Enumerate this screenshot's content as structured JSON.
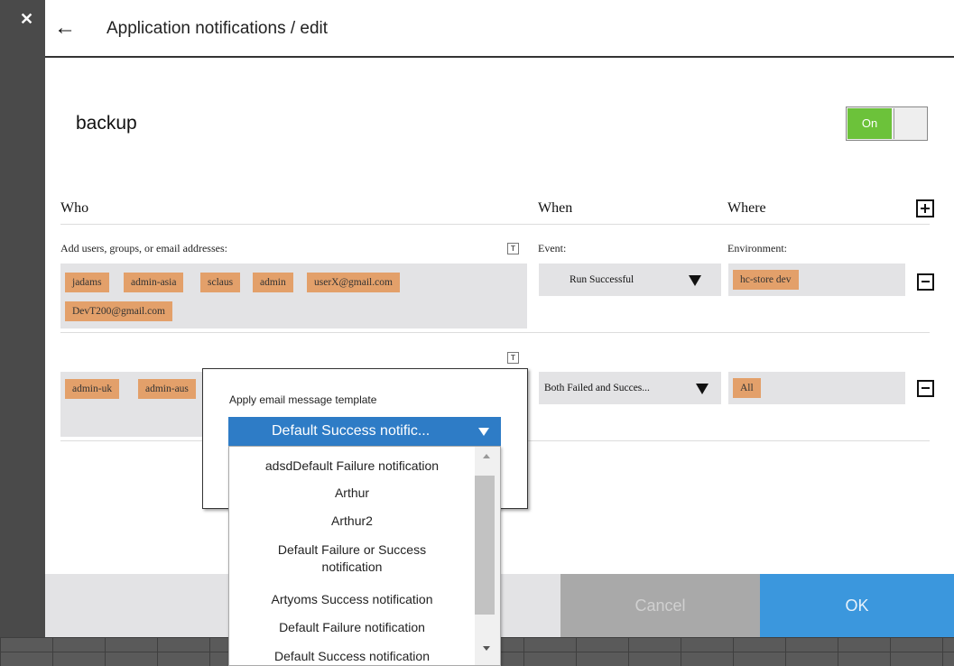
{
  "header": {
    "title": "Application notifications / edit",
    "back_icon": "arrow-left-icon",
    "close_icon": "close-icon"
  },
  "app": {
    "name": "backup",
    "toggle_label": "On",
    "toggle_color": "#6cc23a"
  },
  "columns": {
    "who": "Who",
    "when": "When",
    "where": "Where"
  },
  "rows": [
    {
      "who_label": "Add users, groups, or email addresses:",
      "who_chips": [
        "jadams",
        "admin-asia",
        "sclaus",
        "admin",
        "userX@gmail.com",
        "DevT200@gmail.com"
      ],
      "event_label": "Event:",
      "event_value": "Run Successful",
      "env_label": "Environment:",
      "env_chips": [
        "hc-store dev"
      ]
    },
    {
      "who_chips": [
        "admin-uk",
        "admin-aus"
      ],
      "event_value": "Both Failed and Succes...",
      "env_chips": [
        "All"
      ]
    }
  ],
  "template_popup": {
    "label": "Apply email message template",
    "selected": "Default Success notific...",
    "options": [
      "adsdDefault Failure notification",
      "Arthur",
      "Arthur2",
      "Default Failure or Success notification",
      "Artyoms Success notification",
      "Default Failure notification",
      "Default Success notification"
    ]
  },
  "footer": {
    "cancel_label": "Cancel",
    "ok_label": "OK",
    "ok_color": "#3b97dd"
  }
}
